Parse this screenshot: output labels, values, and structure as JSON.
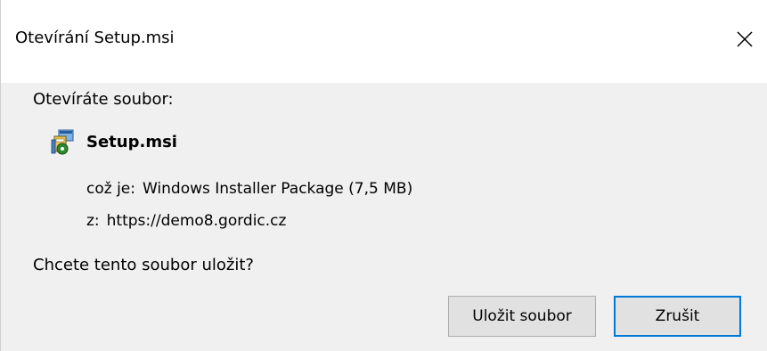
{
  "window": {
    "title": "Otevírání Setup.msi",
    "close_icon": "close-icon"
  },
  "prompt": "Otevíráte soubor:",
  "file": {
    "icon": "msi-package-icon",
    "name": "Setup.msi",
    "type_label": "což je:",
    "type_value": "Windows Installer Package (7,5 MB)",
    "from_label": "z:",
    "from_value": "https://demo8.gordic.cz"
  },
  "question": "Chcete tento soubor uložit?",
  "buttons": {
    "save_label": "Uložit soubor",
    "cancel_label": "Zrušit"
  },
  "colors": {
    "focus_border": "#0078d7",
    "dialog_bg": "#f0f0f0",
    "titlebar_bg": "#ffffff"
  }
}
